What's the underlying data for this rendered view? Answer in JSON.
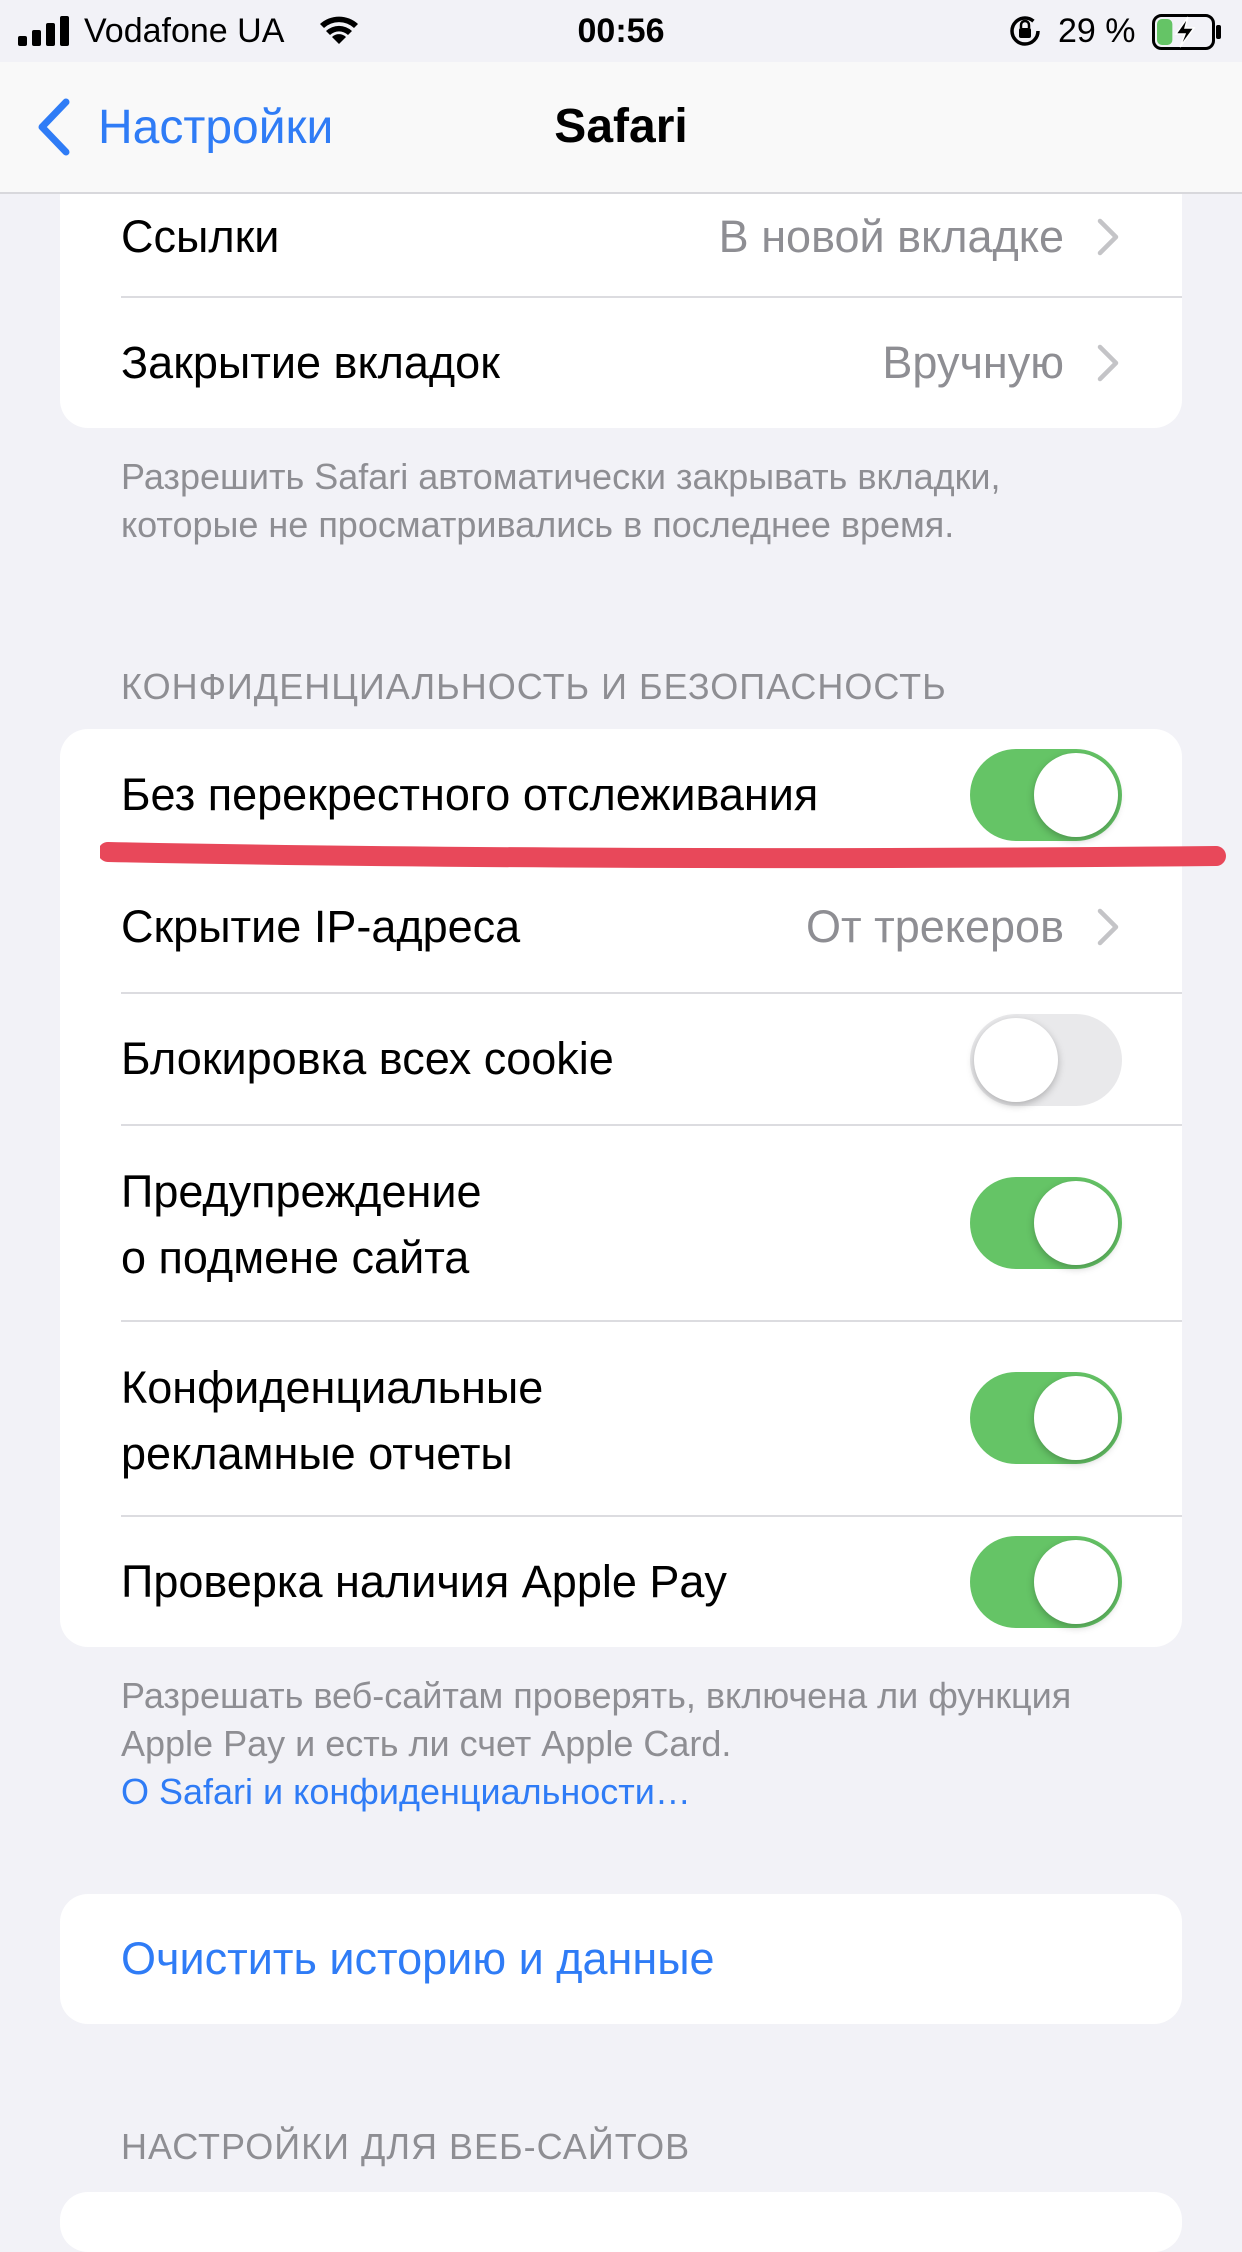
{
  "status_bar": {
    "carrier": "Vodafone UA",
    "time": "00:56",
    "battery_percent": "29 %",
    "battery_level": 0.29,
    "icons": [
      "signal-icon",
      "wifi-icon",
      "orientation-lock-icon",
      "battery-charging-icon"
    ]
  },
  "nav": {
    "back_label": "Настройки",
    "title": "Safari"
  },
  "tabs_group": {
    "rows": [
      {
        "label": "Ссылки",
        "value": "В новой вкладке"
      },
      {
        "label": "Закрытие вкладок",
        "value": "Вручную"
      }
    ],
    "footer": "Разрешить Safari автоматически закрывать вкладки, которые не просматривались в последнее время."
  },
  "privacy": {
    "header": "КОНФИДЕНЦИАЛЬНОСТЬ И БЕЗОПАСНОСТЬ",
    "rows": [
      {
        "label": "Без перекрестного отслеживания",
        "type": "toggle",
        "on": true
      },
      {
        "label": "Скрытие IP-адреса",
        "type": "value",
        "value": "От трекеров"
      },
      {
        "label": "Блокировка всех cookie",
        "type": "toggle",
        "on": false
      },
      {
        "label_line1": "Предупреждение",
        "label_line2": "о подмене сайта",
        "type": "toggle",
        "on": true
      },
      {
        "label_line1": "Конфиденциальные",
        "label_line2": "рекламные отчеты",
        "type": "toggle",
        "on": true
      },
      {
        "label": "Проверка наличия Apple Pay",
        "type": "toggle",
        "on": true
      }
    ],
    "footer": "Разрешать веб-сайтам проверять, включена ли функция Apple Pay и есть ли счет Apple Card.",
    "footer_link": "О Safari и конфиденциальности…"
  },
  "clear_action": {
    "label": "Очистить историю и данные"
  },
  "websites": {
    "header": "НАСТРОЙКИ ДЛЯ ВЕБ-САЙТОВ"
  },
  "colors": {
    "accent": "#2f7cf6",
    "toggle_on": "#65c466",
    "toggle_off": "#e9e9eb",
    "annotation": "#e8485a",
    "background": "#f2f2f7"
  }
}
